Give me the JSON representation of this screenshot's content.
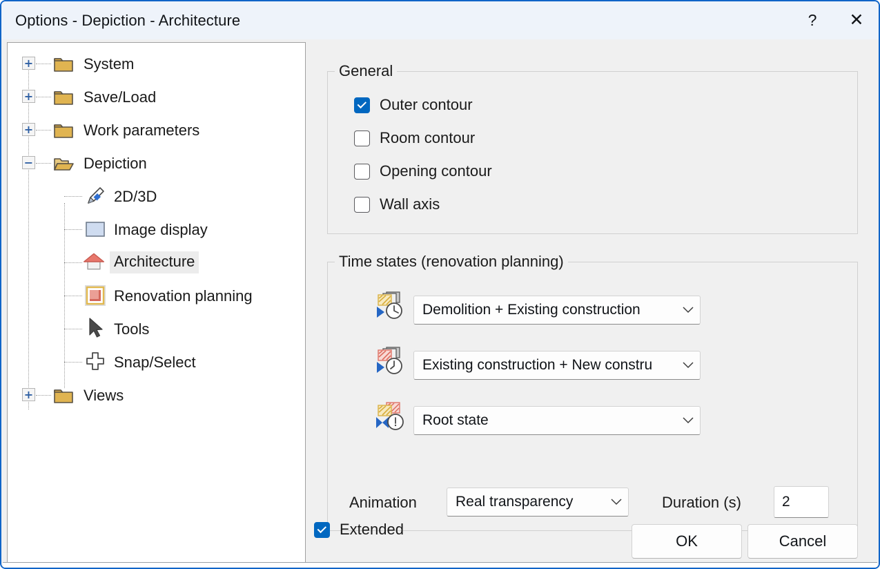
{
  "window": {
    "title": "Options - Depiction - Architecture",
    "help_label": "?",
    "close_label": "✕"
  },
  "tree": {
    "items": [
      {
        "label": "System",
        "icon": "folder-closed-icon",
        "expander": "+",
        "level": 0
      },
      {
        "label": "Save/Load",
        "icon": "folder-closed-icon",
        "expander": "+",
        "level": 0
      },
      {
        "label": "Work parameters",
        "icon": "folder-closed-icon",
        "expander": "+",
        "level": 0
      },
      {
        "label": "Depiction",
        "icon": "folder-open-icon",
        "expander": "−",
        "level": 0
      },
      {
        "label": "2D/3D",
        "icon": "pencil-icon",
        "expander": "",
        "level": 1
      },
      {
        "label": "Image display",
        "icon": "image-rect-icon",
        "expander": "",
        "level": 1
      },
      {
        "label": "Architecture",
        "icon": "house-icon",
        "expander": "",
        "level": 1,
        "selected": true
      },
      {
        "label": "Renovation planning",
        "icon": "framed-wall-icon",
        "expander": "",
        "level": 1
      },
      {
        "label": "Tools",
        "icon": "arrow-cursor-icon",
        "expander": "",
        "level": 1
      },
      {
        "label": "Snap/Select",
        "icon": "plus-outline-icon",
        "expander": "",
        "level": 1
      },
      {
        "label": "Views",
        "icon": "folder-closed-icon",
        "expander": "+",
        "level": 0
      }
    ]
  },
  "general": {
    "legend": "General",
    "checkboxes": [
      {
        "label": "Outer contour",
        "checked": true
      },
      {
        "label": "Room contour",
        "checked": false
      },
      {
        "label": "Opening contour",
        "checked": false
      },
      {
        "label": "Wall axis",
        "checked": false
      }
    ]
  },
  "time_states": {
    "legend": "Time states (renovation planning)",
    "rows": [
      {
        "icon": "time-state-back-icon",
        "value": "Demolition + Existing construction"
      },
      {
        "icon": "time-state-forward-icon",
        "value": "Existing construction + New constru"
      },
      {
        "icon": "time-state-root-icon",
        "value": "Root state"
      }
    ],
    "animation_label": "Animation",
    "animation_value": "Real transparency",
    "duration_label": "Duration (s)",
    "duration_value": "2"
  },
  "footer": {
    "extended_label": "Extended",
    "extended_checked": true,
    "ok_label": "OK",
    "cancel_label": "Cancel"
  },
  "colors": {
    "accent": "#0067c0",
    "window_border": "#0f64c8",
    "panel_bg": "#f0f0f0",
    "titlebar_bg": "#eef3fa",
    "folder": "#e0b451",
    "roof_red": "#e8776c",
    "gold": "#e2b94f"
  }
}
